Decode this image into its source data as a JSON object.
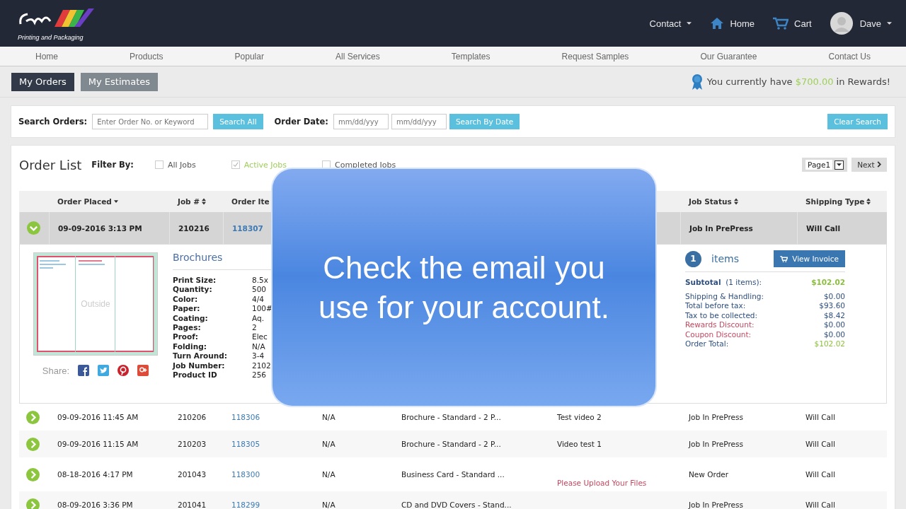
{
  "header": {
    "logo_tagline": "Printing and Packaging",
    "menu": [
      {
        "label": "Contact",
        "kind": "dropdown"
      },
      {
        "label": "Home",
        "kind": "home"
      },
      {
        "label": "Cart",
        "kind": "cart"
      },
      {
        "label": "Dave",
        "kind": "user"
      }
    ]
  },
  "nav": [
    "Home",
    "Products",
    "Popular",
    "All Services",
    "Templates",
    "Request Samples",
    "Our Guarantee",
    "Contact Us"
  ],
  "tabs": [
    {
      "label": "My Orders",
      "selected": true
    },
    {
      "label": "My Estimates",
      "selected": false
    }
  ],
  "rewards": {
    "before": "You currently have",
    "amount": "$700.00",
    "after": "in Rewards!"
  },
  "search": {
    "label": "Search Orders:",
    "placeholder": "Enter Order No. or Keyword",
    "button": "Search All",
    "date_label": "Order Date:",
    "date_from_placeholder": "mm/dd/yyy",
    "date_to_placeholder": "mm/dd/yyy",
    "date_button": "Search By Date",
    "clear_button": "Clear Search"
  },
  "order_list": {
    "title": "Order List",
    "filter_label": "Filter By:",
    "filters": [
      {
        "label": "All Jobs",
        "checked": false
      },
      {
        "label": "Active Jobs",
        "checked": true
      },
      {
        "label": "Completed Jobs",
        "checked": false
      }
    ],
    "page_select": "Page1",
    "next": "Next"
  },
  "table": {
    "columns_left": [
      {
        "label": "Order Placed",
        "sorted": true
      },
      {
        "label": "Job #",
        "sorted": false
      },
      {
        "label": "Order Ite"
      }
    ],
    "columns_right": [
      {
        "label": "Job Status",
        "sorted": false
      },
      {
        "label": "Shipping Type",
        "sorted": false
      }
    ],
    "rows": [
      {
        "expanded": true,
        "date": "09-09-2016 3:13 PM",
        "job": "210216",
        "item": "118307",
        "status": "Job In PrePress",
        "shipping": "Will Call"
      },
      {
        "expanded": false,
        "date": "09-09-2016 11:45 AM",
        "job": "210206",
        "item": "118306",
        "estimate": "N/A",
        "product": "Brochure - Standard - 2 P...",
        "job_name": "Test video 2",
        "status": "Job In PrePress",
        "shipping": "Will Call"
      },
      {
        "expanded": false,
        "date": "09-09-2016 11:15 AM",
        "job": "210203",
        "item": "118305",
        "estimate": "N/A",
        "product": "Brochure - Standard - 2 P...",
        "job_name": "Video test 1",
        "status": "Job In PrePress",
        "shipping": "Will Call"
      },
      {
        "expanded": false,
        "date": "08-18-2016 4:17 PM",
        "job": "201043",
        "item": "118300",
        "estimate": "N/A",
        "product": "Business Card - Standard ...",
        "note": "Please Upload Your Files",
        "status": "New Order",
        "shipping": "Will Call"
      },
      {
        "expanded": false,
        "date": "08-09-2016 3:36 PM",
        "job": "201041",
        "item": "118299",
        "estimate": "N/A",
        "product": "CD and DVD Covers - Stand...",
        "status": "Job In PrePress",
        "shipping": "Will Call"
      }
    ]
  },
  "detail": {
    "title": "Brochures",
    "thumb_label": "Outside",
    "share_label": "Share:",
    "specs": [
      {
        "label": "Print Size:",
        "value": "8.5x"
      },
      {
        "label": "Quantity:",
        "value": "500"
      },
      {
        "label": "Color:",
        "value": "4/4"
      },
      {
        "label": "Paper:",
        "value": "100#"
      },
      {
        "label": "Coating:",
        "value": "Aq."
      },
      {
        "label": "Pages:",
        "value": "2"
      },
      {
        "label": "Proof:",
        "value": "Elec"
      },
      {
        "label": "Folding:",
        "value": "N/A"
      },
      {
        "label": "Turn Around:",
        "value": "3-4"
      },
      {
        "label": "Job Number:",
        "value": "2102"
      },
      {
        "label": "Product ID",
        "value": "256"
      }
    ],
    "count": "1",
    "count_label": "items",
    "invoice_button": "View Invoice",
    "totals": [
      {
        "kind": "subtotal",
        "label": "Subtotal",
        "note": "(1 items):",
        "value": "$102.02"
      },
      {
        "kind": "line",
        "label": "Shipping & Handling:",
        "value": "$0.00"
      },
      {
        "kind": "line",
        "label": "Total before tax:",
        "value": "$93.60"
      },
      {
        "kind": "line",
        "label": "Tax to be collected:",
        "value": "$8.42"
      },
      {
        "kind": "discount",
        "label": "Rewards Discount:",
        "value": "$0.00"
      },
      {
        "kind": "discount",
        "label": "Coupon Discount:",
        "value": "$0.00"
      },
      {
        "kind": "total",
        "label": "Order Total:",
        "value": "$102.02"
      }
    ]
  },
  "caption": [
    "Check the email you",
    "use for your account."
  ]
}
